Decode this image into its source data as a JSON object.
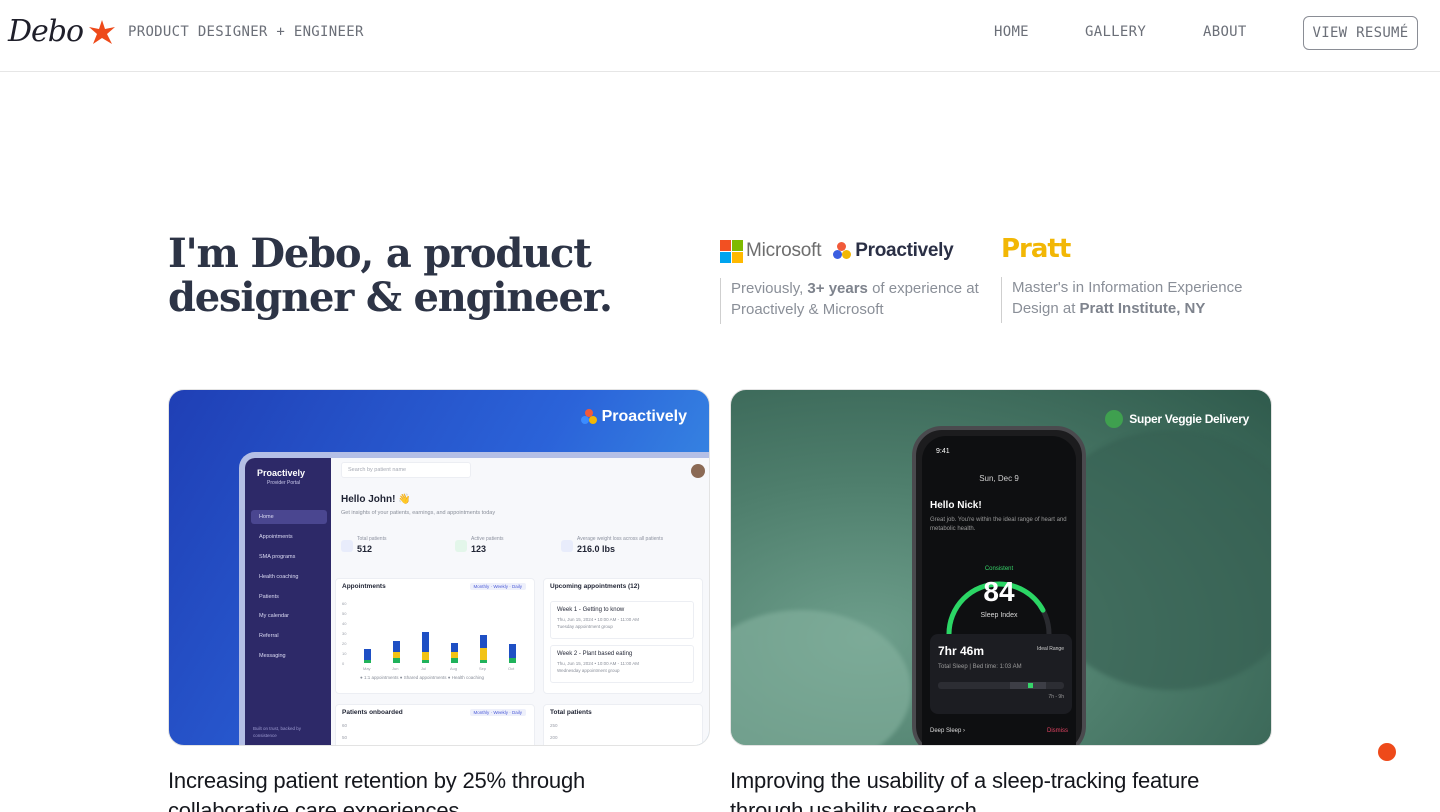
{
  "nav": {
    "logo_text": "Debo",
    "tagline": "PRODUCT DESIGNER + ENGINEER",
    "links": [
      "HOME",
      "GALLERY",
      "ABOUT"
    ],
    "resume_button": "VIEW RESUMÉ",
    "star_color": "#ee4a1a"
  },
  "hero": {
    "title_line1": "I'm Debo, a product",
    "title_line2": "designer & engineer."
  },
  "credentials": {
    "logos": {
      "microsoft": "Microsoft",
      "proactively": "Proactively",
      "pratt": "Pratt"
    },
    "experience": {
      "pre": "Previously, ",
      "bold": "3+ years",
      "post": " of experience at Proactively & Microsoft"
    },
    "education": {
      "pre": "Master's in Information Experience Design at ",
      "bold": "Pratt Institute, NY"
    },
    "pratt_color": "#f2b705"
  },
  "cards": [
    {
      "brand": "Proactively",
      "caption_line1": "Increasing patient retention by 25% through",
      "caption_line2": "collaborative care experiences",
      "dashboard": {
        "sidebar_title": "Proactively",
        "sidebar_sub": "Provider Portal",
        "nav_items": [
          "Home",
          "Appointments",
          "SMA programs",
          "Health coaching",
          "Patients",
          "My calendar",
          "Referral",
          "Messaging"
        ],
        "sidebar_footer": "Built on trust, backed by consistence",
        "search_placeholder": "Search by patient name",
        "user_initial": "Jo",
        "greeting": "Hello John! 👋",
        "greeting_sub": "Get insights of your patients, earnings, and appointments today",
        "stats": [
          {
            "label": "Total patients",
            "value": "512"
          },
          {
            "label": "Active patients",
            "value": "123"
          },
          {
            "label": "Average weight loss across all patients",
            "value": "216.0 lbs"
          }
        ],
        "appointments_title": "Appointments",
        "segment": [
          "Monthly",
          "Weekly",
          "Daily"
        ],
        "y_ticks": [
          "60",
          "50",
          "40",
          "30",
          "20",
          "10",
          "0"
        ],
        "months": [
          "May",
          "Jun",
          "Jul",
          "Aug",
          "Sep",
          "Oct"
        ],
        "bars": [
          [
            3,
            0,
            11
          ],
          [
            5,
            6,
            11
          ],
          [
            3,
            8,
            20
          ],
          [
            5,
            6,
            9
          ],
          [
            3,
            12,
            13
          ],
          [
            5,
            0,
            14
          ]
        ],
        "bar_colors": [
          "#20b25b",
          "#f2c316",
          "#1e4fc4"
        ],
        "legend": "● 1:1 appointments   ● Shared appointments   ● Health coaching",
        "upcoming_title": "Upcoming appointments (12)",
        "upcoming": [
          {
            "title": "Week 1 - Getting to know",
            "date": "Thu, Jun 15, 2024  •  10:00 AM - 11:00 AM",
            "group": "Tuesday appointment group"
          },
          {
            "title": "Week 2 - Plant based eating",
            "date": "Thu, Jun 15, 2024  •  10:00 AM - 11:00 AM",
            "group": "Wednesday appointment group"
          }
        ],
        "onboarded_title": "Patients onboarded",
        "total_patients_title": "Total patients",
        "onboard_ticks": [
          "60",
          "50"
        ],
        "total_ticks": [
          "250",
          "200"
        ]
      }
    },
    {
      "brand": "Super Veggie Delivery",
      "caption_line1": "Improving the usability of a sleep-tracking feature",
      "caption_line2": "through usability research",
      "phone": {
        "time": "9:41",
        "date": "Sun, Dec 9",
        "greeting": "Hello Nick!",
        "desc": "Great job. You're within the ideal range of heart and metabolic health.",
        "status": "Consistent",
        "score": "84",
        "score_label": "Sleep Index",
        "sleep_duration": "7hr 46m",
        "ideal_label": "Ideal Range",
        "sleep_detail": "Total Sleep  |  Bed time: 1:03 AM",
        "range": "7h - 9h",
        "deep_sleep": "Deep Sleep  ›",
        "dismiss": "Dismiss",
        "gauge_fraction": 0.84
      }
    }
  ]
}
